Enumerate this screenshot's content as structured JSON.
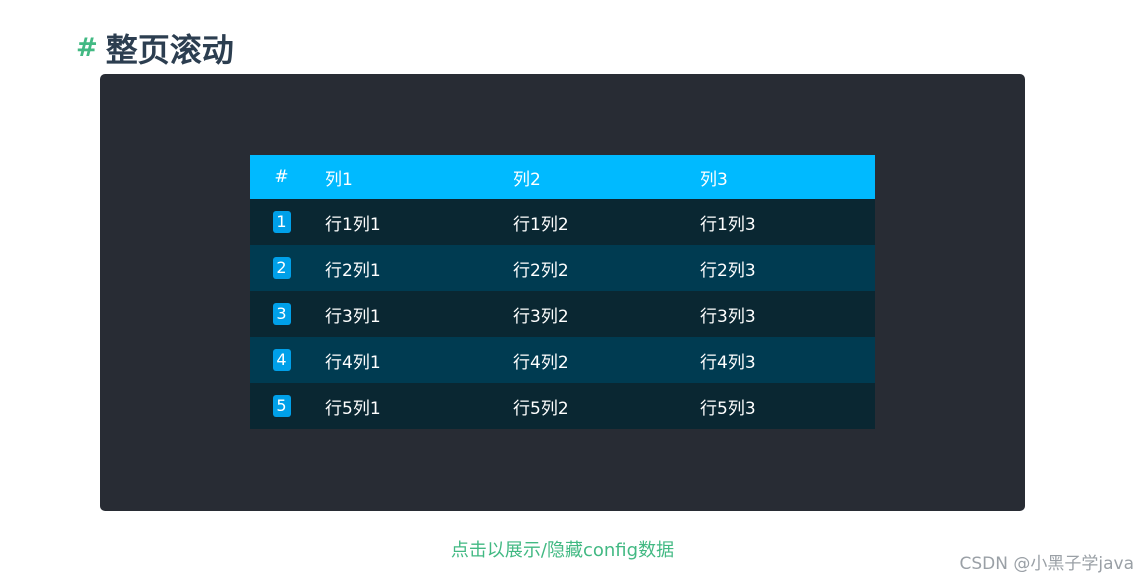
{
  "heading": {
    "hash": "#",
    "title": "整页滚动"
  },
  "board": {
    "header": [
      "#",
      "列1",
      "列2",
      "列3"
    ],
    "rows": [
      {
        "index": "1",
        "cells": [
          "行1列1",
          "行1列2",
          "行1列3"
        ]
      },
      {
        "index": "2",
        "cells": [
          "行2列1",
          "行2列2",
          "行2列3"
        ]
      },
      {
        "index": "3",
        "cells": [
          "行3列1",
          "行3列2",
          "行3列3"
        ]
      },
      {
        "index": "4",
        "cells": [
          "行4列1",
          "行4列2",
          "行4列3"
        ]
      },
      {
        "index": "5",
        "cells": [
          "行5列1",
          "行5列2",
          "行5列3"
        ]
      }
    ]
  },
  "toggle": {
    "label": "点击以展示/隐藏config数据"
  },
  "watermark": "CSDN @小黑子学java",
  "colors": {
    "header_bg": "#00baff",
    "odd_row_bg": "#0a2732",
    "even_row_bg": "#003b51",
    "index_badge_bg": "#00a0e9",
    "demo_bg": "#282c34",
    "accent": "#42b983",
    "title": "#2c3e50"
  }
}
